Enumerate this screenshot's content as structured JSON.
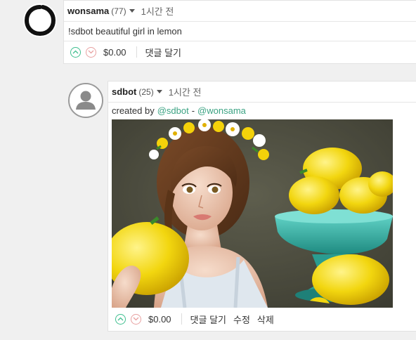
{
  "comments": [
    {
      "author": "wonsama",
      "reputation": "(77)",
      "time": "1시간 전",
      "body": "!sdbot beautiful girl in lemon",
      "payout": "$0.00",
      "actions": [
        "댓글 달기"
      ]
    },
    {
      "author": "sdbot",
      "reputation": "(25)",
      "time": "1시간 전",
      "created_prefix": "created by",
      "creator_link": "@sdbot",
      "separator": "-",
      "requester_link": "@wonsama",
      "payout": "$0.00",
      "actions": [
        "댓글 달기",
        "수정",
        "삭제"
      ]
    }
  ],
  "colors": {
    "upvote": "#3fbf8f",
    "downvote": "#e8a0a0",
    "link": "#3ba383"
  },
  "icons": [
    "brush-circle-avatar",
    "default-user-avatar",
    "upvote-chevron-icon",
    "downvote-chevron-icon",
    "caret-down-icon"
  ]
}
